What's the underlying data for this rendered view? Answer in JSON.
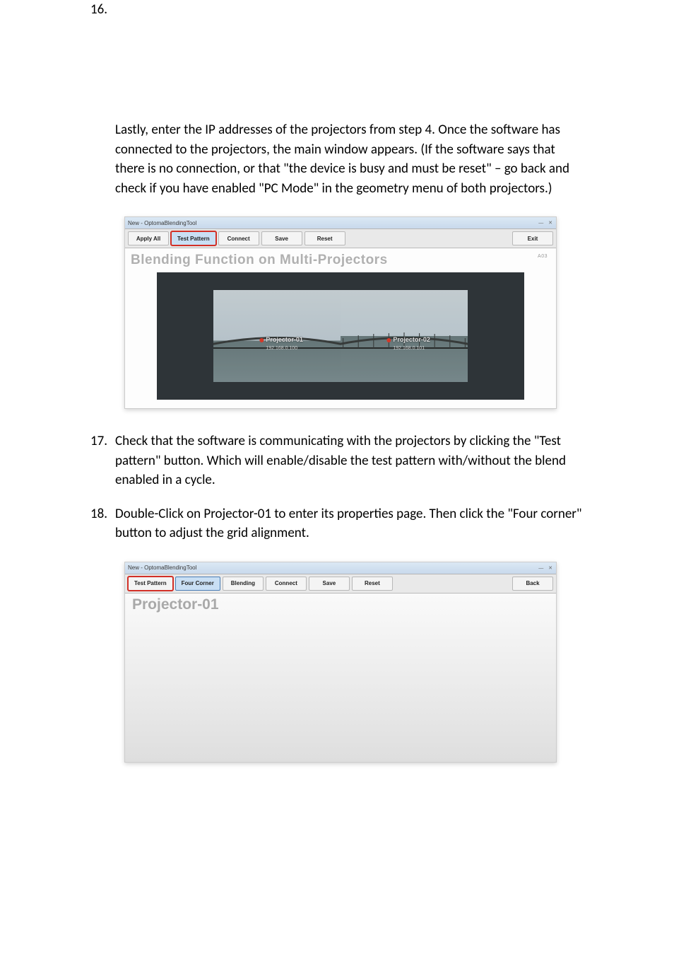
{
  "steps": {
    "s16": {
      "num": "16.",
      "text": "Lastly, enter the IP addresses of the projectors from step 4. Once the software has connected to the projectors, the main window appears. (If the software says that there is no connection, or that \"the device is busy and must be reset\" – go back and check if you have enabled \"PC Mode\" in the geometry menu of both projectors.)"
    },
    "s17": {
      "num": "17.",
      "text": "Check that the software is communicating with the projectors by clicking the \"Test pattern\" button. Which will enable/disable the test pattern with/without the blend enabled in a cycle."
    },
    "s18": {
      "num": "18.",
      "text": "Double-Click on Projector-01 to enter its properties page. Then click the \"Four corner\" button to adjust the grid alignment."
    }
  },
  "shotA": {
    "title": "New - OptomaBlendingTool",
    "toolbar": {
      "applyAll": "Apply All",
      "testPattern": "Test Pattern",
      "connect": "Connect",
      "save": "Save",
      "reset": "Reset",
      "exit": "Exit"
    },
    "banner": "Blending Function on Multi-Projectors",
    "version": "A03",
    "proj1": {
      "label": "Projector-01",
      "ip": "192.168.0.100"
    },
    "proj2": {
      "label": "Projector-02",
      "ip": "192.168.0.101"
    }
  },
  "shotB": {
    "title": "New - OptomaBlendingTool",
    "toolbar": {
      "testPattern": "Test Pattern",
      "fourCorner": "Four Corner",
      "blending": "Blending",
      "connect": "Connect",
      "save": "Save",
      "reset": "Reset",
      "back": "Back"
    },
    "heading": "Projector-01"
  }
}
